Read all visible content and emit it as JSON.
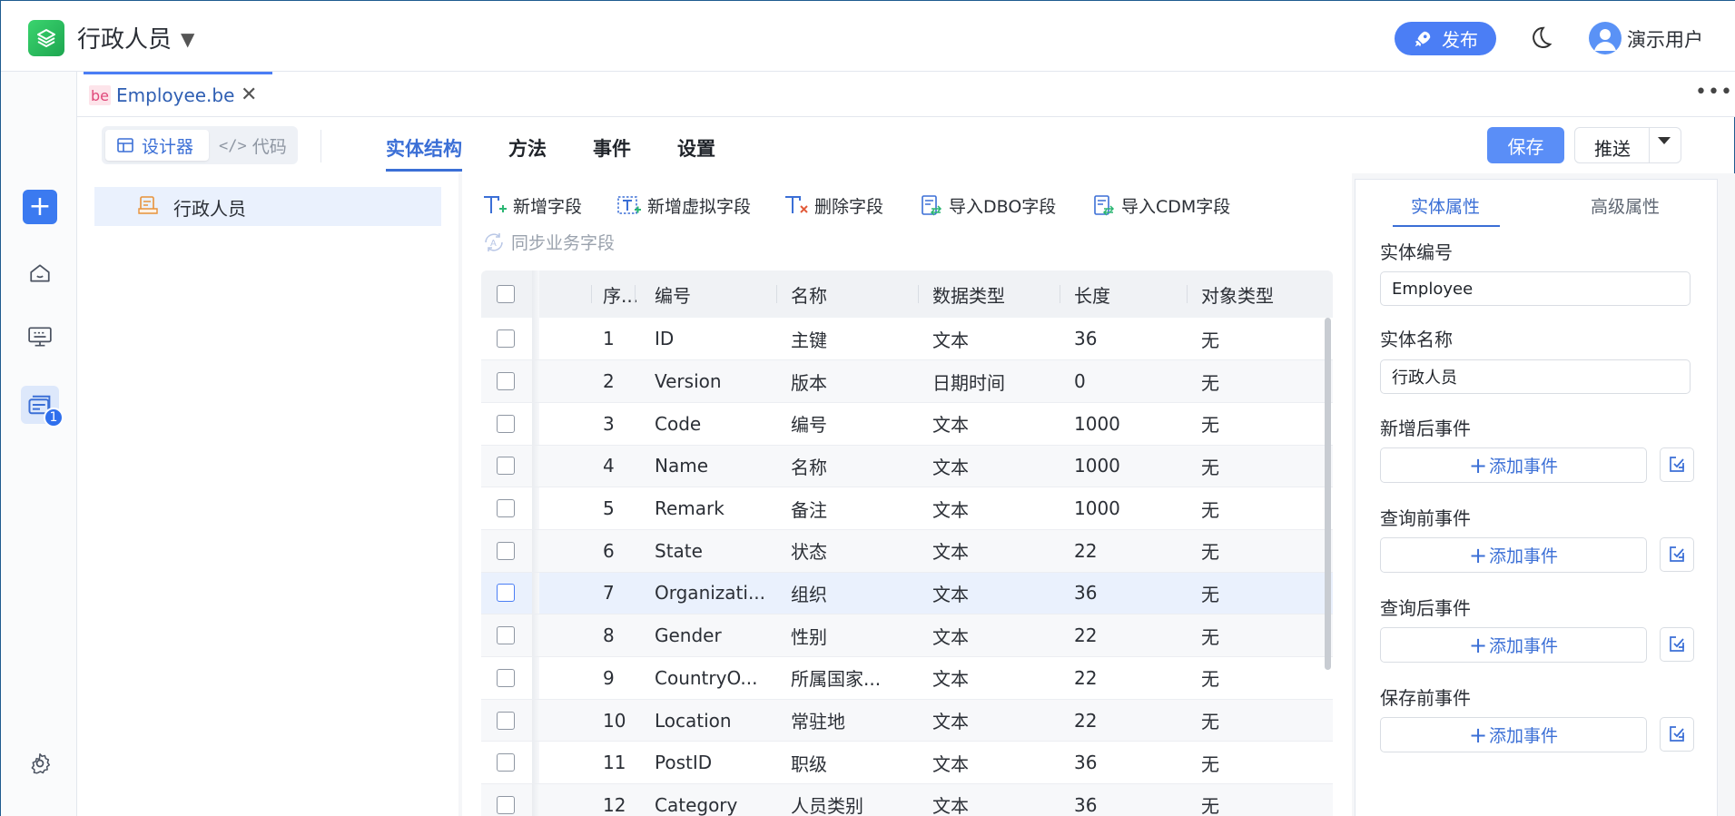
{
  "header": {
    "app_title": "行政人员",
    "publish_label": "发布",
    "user_name": "演示用户"
  },
  "rail": {
    "badge_count": "1"
  },
  "file_tab": {
    "badge": "be",
    "label": "Employee.be"
  },
  "toolbar": {
    "designer_label": "设计器",
    "code_label": "代码",
    "tabs": [
      "实体结构",
      "方法",
      "事件",
      "设置"
    ],
    "active_tab": "实体结构",
    "save_label": "保存",
    "push_label": "推送"
  },
  "tree": {
    "items": [
      {
        "label": "行政人员"
      }
    ]
  },
  "field_actions": {
    "add_field": "新增字段",
    "add_virtual_field": "新增虚拟字段",
    "delete_field": "删除字段",
    "import_dbo": "导入DBO字段",
    "import_cdm": "导入CDM字段",
    "sync_business": "同步业务字段"
  },
  "table": {
    "columns": [
      "序...",
      "编号",
      "名称",
      "数据类型",
      "长度",
      "对象类型"
    ],
    "rows": [
      {
        "seq": "1",
        "code": "ID",
        "name": "主键",
        "type": "文本",
        "length": "36",
        "obj": "无"
      },
      {
        "seq": "2",
        "code": "Version",
        "name": "版本",
        "type": "日期时间",
        "length": "0",
        "obj": "无"
      },
      {
        "seq": "3",
        "code": "Code",
        "name": "编号",
        "type": "文本",
        "length": "1000",
        "obj": "无"
      },
      {
        "seq": "4",
        "code": "Name",
        "name": "名称",
        "type": "文本",
        "length": "1000",
        "obj": "无"
      },
      {
        "seq": "5",
        "code": "Remark",
        "name": "备注",
        "type": "文本",
        "length": "1000",
        "obj": "无"
      },
      {
        "seq": "6",
        "code": "State",
        "name": "状态",
        "type": "文本",
        "length": "22",
        "obj": "无"
      },
      {
        "seq": "7",
        "code": "Organizati...",
        "name": "组织",
        "type": "文本",
        "length": "36",
        "obj": "无"
      },
      {
        "seq": "8",
        "code": "Gender",
        "name": "性别",
        "type": "文本",
        "length": "22",
        "obj": "无"
      },
      {
        "seq": "9",
        "code": "CountryO...",
        "name": "所属国家...",
        "type": "文本",
        "length": "22",
        "obj": "无"
      },
      {
        "seq": "10",
        "code": "Location",
        "name": "常驻地",
        "type": "文本",
        "length": "22",
        "obj": "无"
      },
      {
        "seq": "11",
        "code": "PostID",
        "name": "职级",
        "type": "文本",
        "length": "36",
        "obj": "无"
      },
      {
        "seq": "12",
        "code": "Category",
        "name": "人员类别",
        "type": "文本",
        "length": "36",
        "obj": "无"
      }
    ]
  },
  "properties": {
    "tabs": [
      "实体属性",
      "高级属性"
    ],
    "active_tab": "实体属性",
    "entity_code_label": "实体编号",
    "entity_code_value": "Employee",
    "entity_name_label": "实体名称",
    "entity_name_value": "行政人员",
    "add_event_label": "添加事件",
    "events": [
      {
        "label": "新增后事件"
      },
      {
        "label": "查询前事件"
      },
      {
        "label": "查询后事件"
      },
      {
        "label": "保存前事件"
      }
    ]
  }
}
